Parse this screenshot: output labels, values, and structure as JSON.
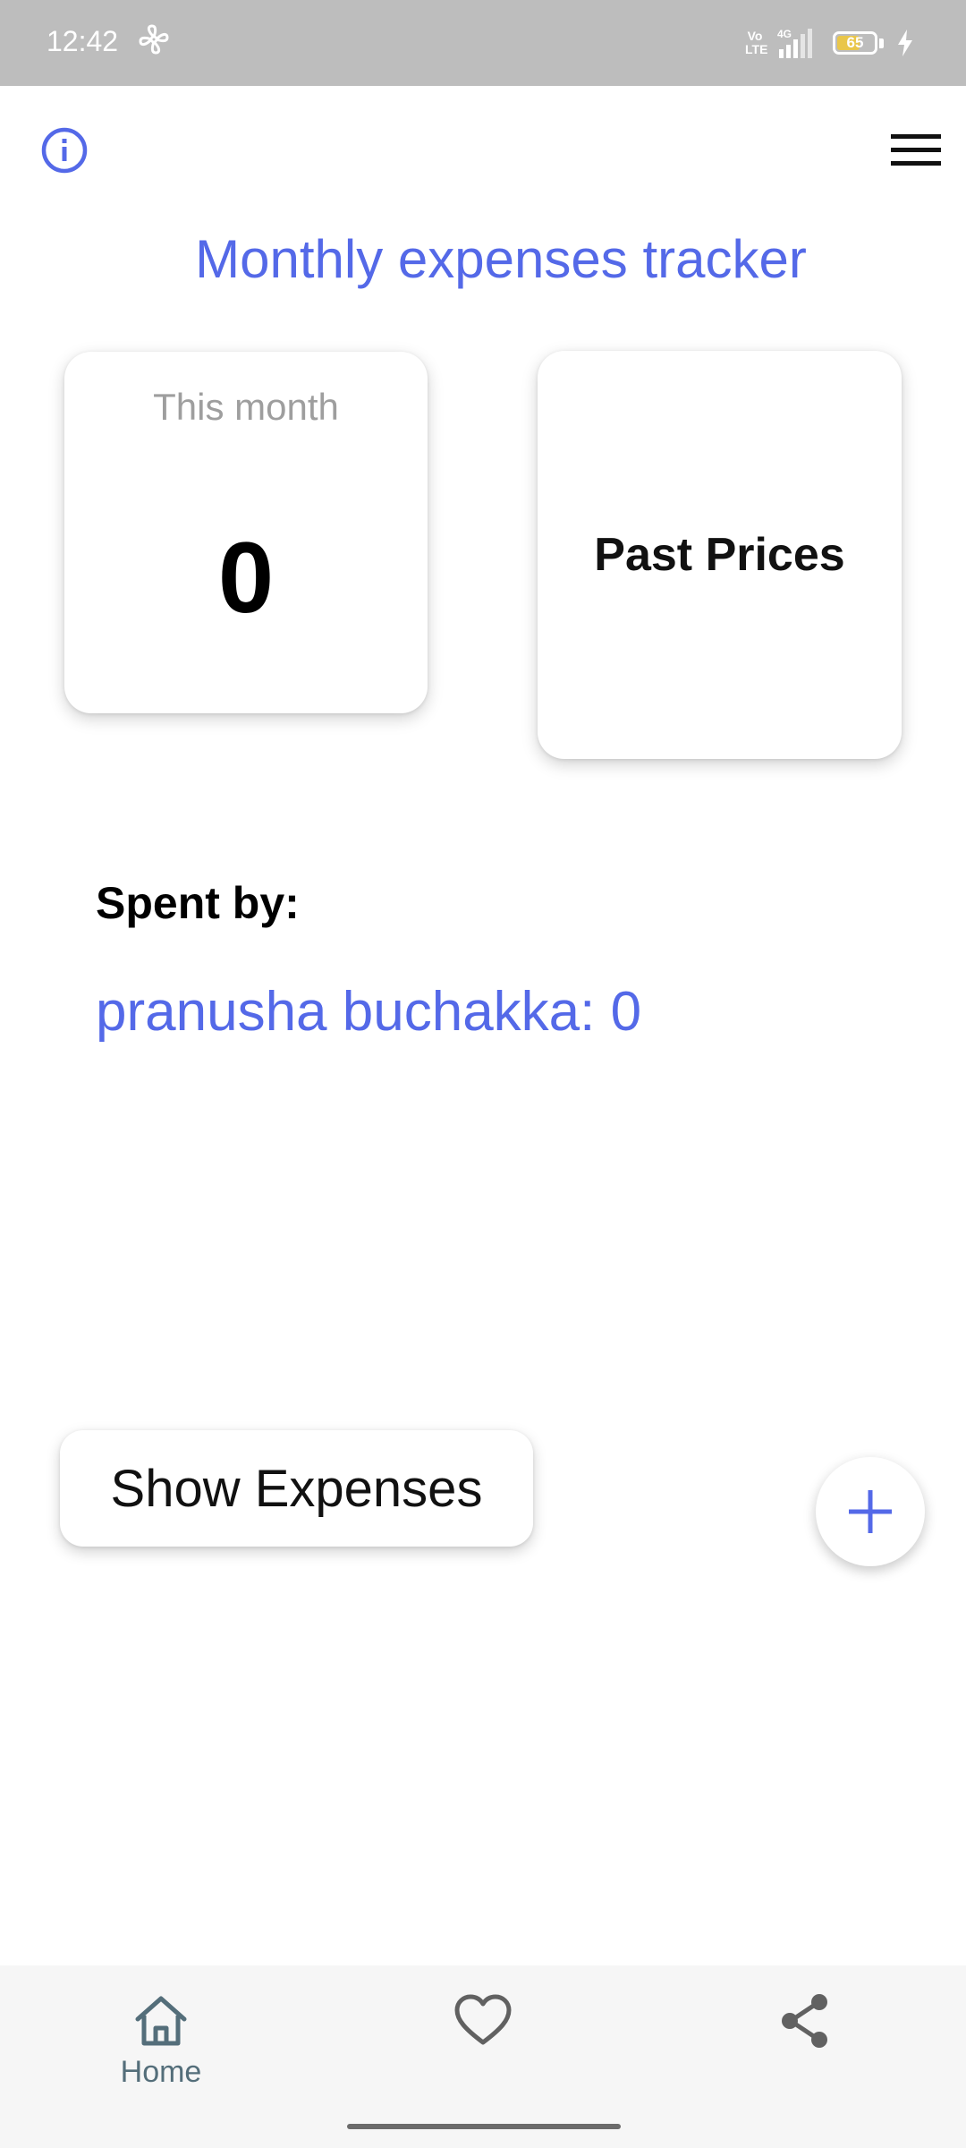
{
  "status_bar": {
    "time": "12:42",
    "network_volte": "Vo LTE",
    "network_type": "4G",
    "battery_level": "65",
    "battery_fraction": 0.65
  },
  "header": {
    "title": "Monthly expenses tracker",
    "info_icon": "info-icon",
    "menu_icon": "hamburger-menu-icon"
  },
  "cards": {
    "this_month_label": "This month",
    "this_month_value": "0",
    "past_prices_label": "Past Prices"
  },
  "spent": {
    "label": "Spent by:",
    "entries": [
      {
        "text": "pranusha buchakka: 0"
      }
    ]
  },
  "actions": {
    "show_expenses_label": "Show Expenses",
    "add_icon": "plus-icon"
  },
  "bottom_nav": {
    "items": [
      {
        "icon": "home-icon",
        "label": "Home"
      },
      {
        "icon": "heart-icon",
        "label": ""
      },
      {
        "icon": "share-icon",
        "label": ""
      }
    ]
  },
  "colors": {
    "accent": "#5469e8",
    "status_bar": "#bdbdbd",
    "nav_bar": "#f6f6f6",
    "nav_label": "#546e7a",
    "battery": "#e9c64a"
  }
}
